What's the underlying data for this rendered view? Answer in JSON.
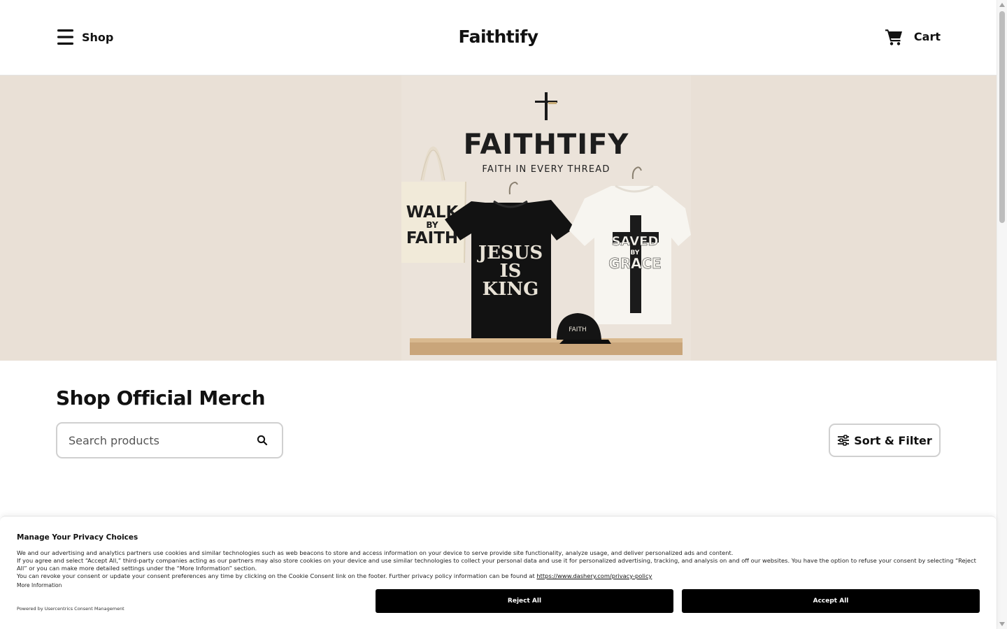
{
  "header": {
    "menu_label": "Shop",
    "brand": "Faithtify",
    "cart_label": "Cart"
  },
  "hero": {
    "logo_text": "FAITHTIFY",
    "tagline": "FAITH IN EVERY THREAD",
    "tote_text": [
      "WALK",
      "BY",
      "FAITH"
    ],
    "black_shirt_text": [
      "JESUS",
      "IS",
      "KING"
    ],
    "white_shirt_text": [
      "SAVED",
      "BY",
      "GRACE"
    ],
    "cap_text": "FAITH"
  },
  "main": {
    "section_title": "Shop Official Merch",
    "search_placeholder": "Search products",
    "sort_filter_label": "Sort & Filter"
  },
  "consent": {
    "title": "Manage Your Privacy Choices",
    "line1": "We and our advertising and analytics partners use cookies and similar technologies such as web beacons to store and access information on your device to serve provide site functionality, analyze usage, and deliver personalized ads and content.",
    "line2": "If you agree and select “Accept All,” third-party companies acting as our partners may also store cookies on your device and use similar technologies to collect your personal data and use it for personalized advertising, tracking, and analysis on and off our websites. You have the option to refuse your consent by selecting “Reject All” or you can make more detailed settings under the “More Information” section.",
    "line3": "You can revoke your consent or update your consent preferences any time by clicking on the Cookie Consent link on the footer. Further privacy policy information can be found at",
    "privacy_link": "https://www.dashery.com/privacy-policy",
    "more_info": "More Information",
    "powered_by": "Powered by Usercentrics Consent Management",
    "reject_label": "Reject All",
    "accept_label": "Accept All"
  }
}
